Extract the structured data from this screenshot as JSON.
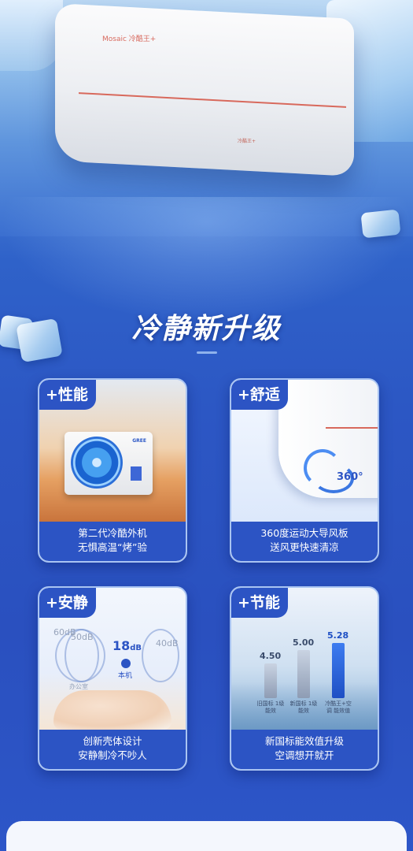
{
  "hero": {
    "product_logo": "Mosaic 冷酷王+",
    "product_badge": "冷酷王+",
    "title": "冷静新升级"
  },
  "cards": [
    {
      "tag": "+性能",
      "lines": [
        "第二代冷酷外机",
        "无惧高温“烤”验"
      ],
      "brand": "GREE"
    },
    {
      "tag": "+舒适",
      "lines": [
        "360度运动大导风板",
        "送风更快速清凉"
      ],
      "angle": "360°"
    },
    {
      "tag": "+安静",
      "lines": [
        "创新壳体设计",
        "安静制冷不吵人"
      ],
      "db_levels": [
        "60dB",
        "50dB",
        "40dB"
      ],
      "db_main": "18",
      "db_unit": "dB",
      "db_label": "本机",
      "db_tag": "办公室"
    },
    {
      "tag": "+节能",
      "lines": [
        "新国标能效值升级",
        "空调想开就开"
      ]
    }
  ],
  "chart_data": {
    "type": "bar",
    "categories": [
      "旧国标 1级能效",
      "新国标 1级能效",
      "冷酷王+空调 能效值"
    ],
    "values": [
      4.5,
      5.0,
      5.28
    ],
    "value_labels": [
      "4.50",
      "5.00",
      "5.28"
    ]
  },
  "colors": {
    "primary_blue": "#2c54c4",
    "accent_red": "#d8695c"
  }
}
